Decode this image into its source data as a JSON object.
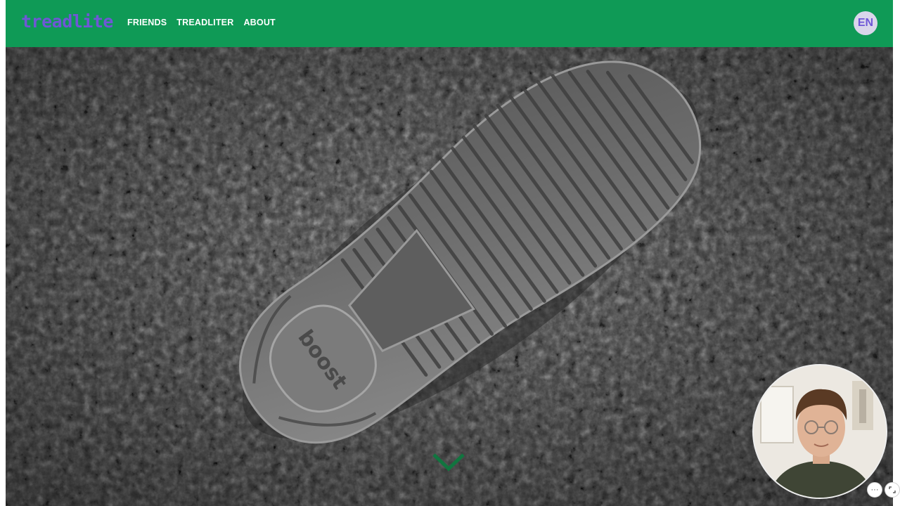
{
  "brand": {
    "logo_text": "treadlite",
    "logo_color": "#6f57d6"
  },
  "nav": {
    "bar_color": "#0f9a56",
    "items": [
      {
        "label": "FRIENDS"
      },
      {
        "label": "TREADLITER"
      },
      {
        "label": "ABOUT"
      }
    ]
  },
  "language": {
    "label": "EN"
  },
  "hero": {
    "image": "black-and-white photo of a sneaker sole footprint pressed into dry soil",
    "sole_imprint_text": "boost",
    "scroll_icon": "chevron-down-icon"
  },
  "video_overlay": {
    "icons": [
      "more-options-icon",
      "expand-icon"
    ],
    "more_label": "···"
  }
}
